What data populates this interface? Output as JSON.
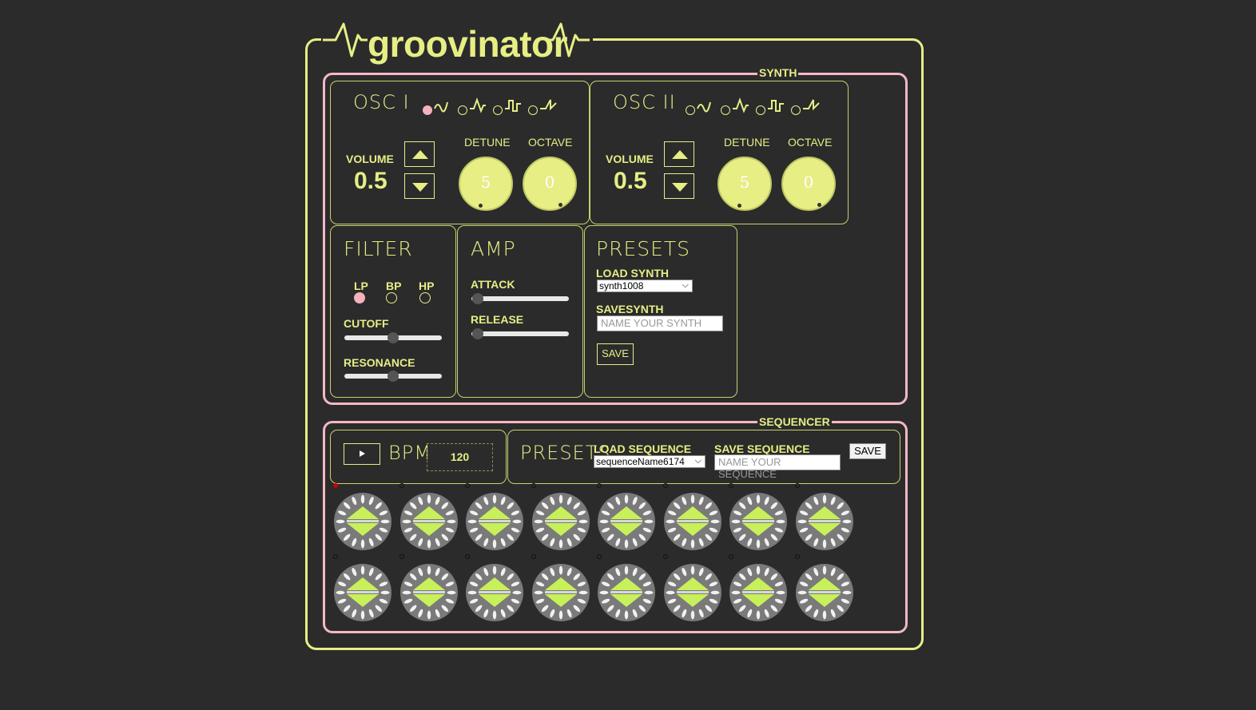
{
  "app": {
    "title": "groovinator"
  },
  "synth": {
    "label": "SYNTH",
    "osc1": {
      "title": "OSC I",
      "volume_label": "VOLUME",
      "volume": "0.5",
      "detune_label": "DETUNE",
      "detune": "5",
      "octave_label": "OCTAVE",
      "octave": "0",
      "waves": [
        "sine-wave-icon",
        "triangle-wave-icon",
        "square-wave-icon",
        "sawtooth-wave-icon"
      ],
      "selected_wave": 0
    },
    "osc2": {
      "title": "OSC II",
      "volume_label": "VOLUME",
      "volume": "0.5",
      "detune_label": "DETUNE",
      "detune": "5",
      "octave_label": "OCTAVE",
      "octave": "0",
      "waves": [
        "sine-wave-icon",
        "triangle-wave-icon",
        "square-wave-icon",
        "sawtooth-wave-icon"
      ],
      "selected_wave": -1
    },
    "filter": {
      "title": "FILTER",
      "types": [
        "LP",
        "BP",
        "HP"
      ],
      "selected_type": "LP",
      "cutoff_label": "CUTOFF",
      "cutoff": 0.5,
      "resonance_label": "RESONANCE",
      "resonance": 0.5
    },
    "amp": {
      "title": "AMP",
      "attack_label": "ATTACK",
      "attack": 0.0,
      "release_label": "RELEASE",
      "release": 0.0
    },
    "presets": {
      "title": "PRESETS",
      "load_label": "LOAD SYNTH",
      "load_value": "synth1008",
      "save_label": "SAVESYNTH",
      "save_placeholder": "NAME YOUR SYNTH",
      "save_button": "SAVE"
    }
  },
  "sequencer": {
    "label": "SEQUENCER",
    "bpm_label": "BPM",
    "bpm": "120",
    "presets_title": "PRESETS",
    "load_label": "LOAD SEQUENCE",
    "load_value": "sequenceName6174",
    "save_label": "SAVE SEQUENCE",
    "save_placeholder": "NAME YOUR SEQUENCE",
    "save_button": "SAVE",
    "rows": 2,
    "steps_per_row": 8,
    "active_step": 0
  },
  "colors": {
    "background": "#2b2b2c",
    "accent": "#e6ee84",
    "pink": "#f2b9c3",
    "pad_green": "#c8f05a",
    "pad_gray": "#7a7a7a"
  }
}
